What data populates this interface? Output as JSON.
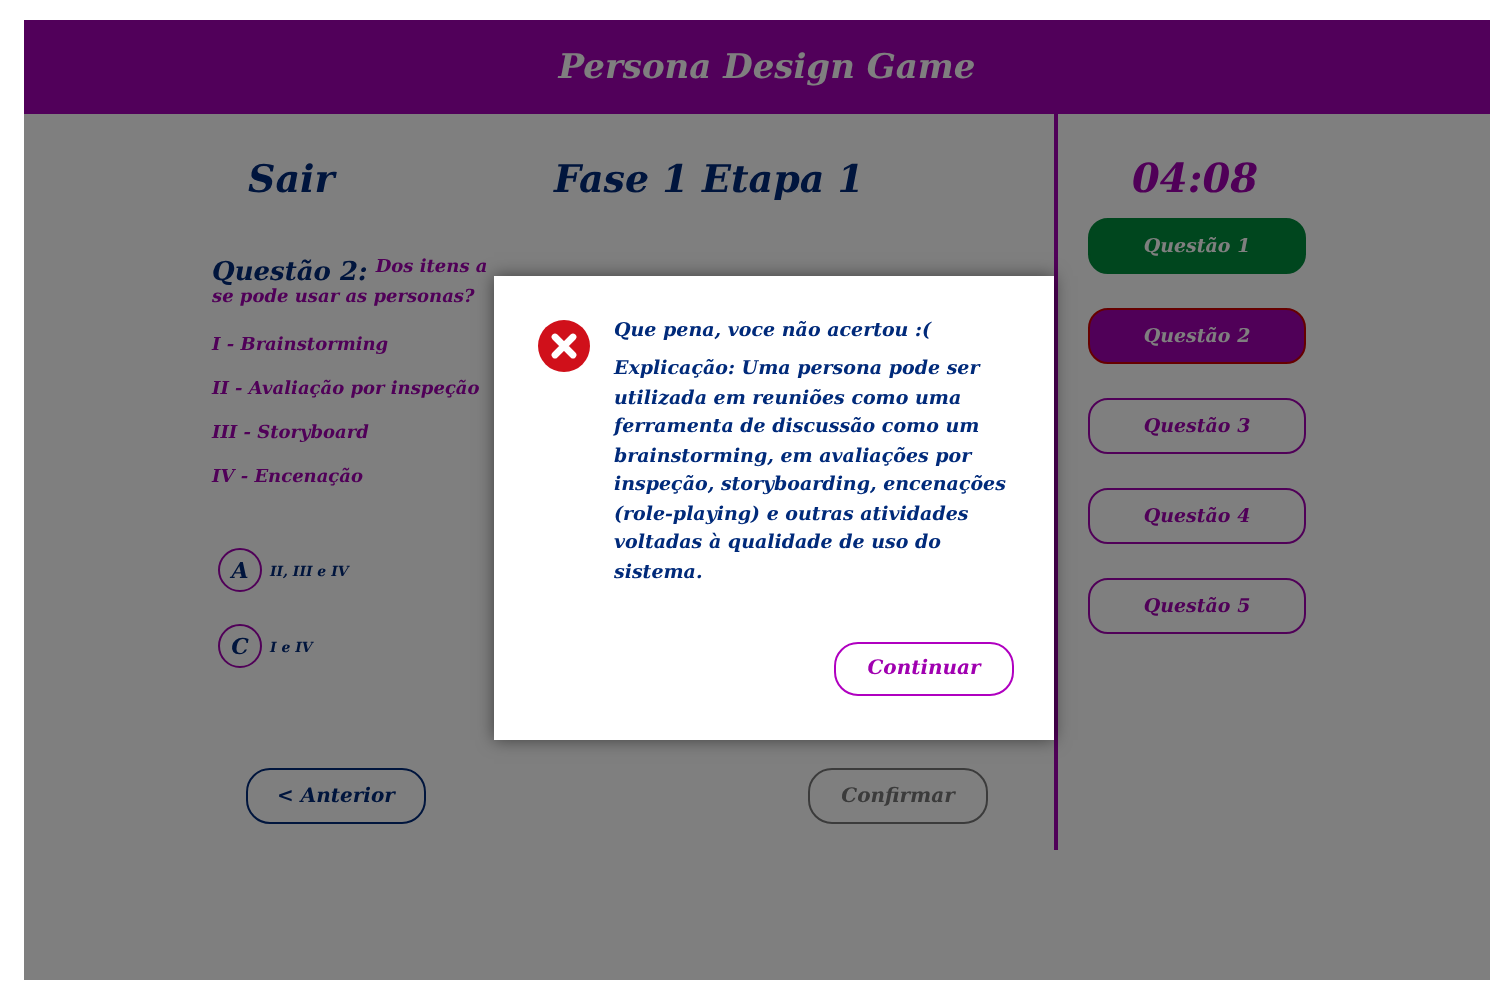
{
  "header": {
    "title": "Persona Design Game"
  },
  "nav": {
    "exit": "Sair",
    "stage": "Fase 1 Etapa 1"
  },
  "question": {
    "label": "Questão 2:",
    "lines": [
      "Dos itens a",
      "se pode usar as personas?"
    ],
    "items": [
      "I - Brainstorming",
      "II - Avaliação por inspeção",
      "III - Storyboard",
      "IV - Encenação"
    ],
    "options": [
      {
        "letter": "A",
        "text": "II, III e IV",
        "selected": false
      },
      {
        "letter": "C",
        "text": "I e IV",
        "selected": false
      }
    ]
  },
  "actions": {
    "previous": "< Anterior",
    "confirm": "Confirmar",
    "confirm_disabled": true
  },
  "timer": "04:08",
  "questions": [
    {
      "label": "Questão 1",
      "kind": "correct"
    },
    {
      "label": "Questão 2",
      "kind": "current"
    },
    {
      "label": "Questão 3",
      "kind": "pending"
    },
    {
      "label": "Questão 4",
      "kind": "pending"
    },
    {
      "label": "Questão 5",
      "kind": "pending"
    }
  ],
  "dialog": {
    "title": "Que pena, voce não acertou :(",
    "explanation": "Explicação: Uma persona pode ser utilizada em reuniões como uma ferramenta de discussão como um brainstorming, em avaliações por inspeção, storyboarding, encenações (role-playing) e outras atividades voltadas à qualidade de uso do sistema.",
    "button": "Continuar",
    "kind": "error"
  }
}
